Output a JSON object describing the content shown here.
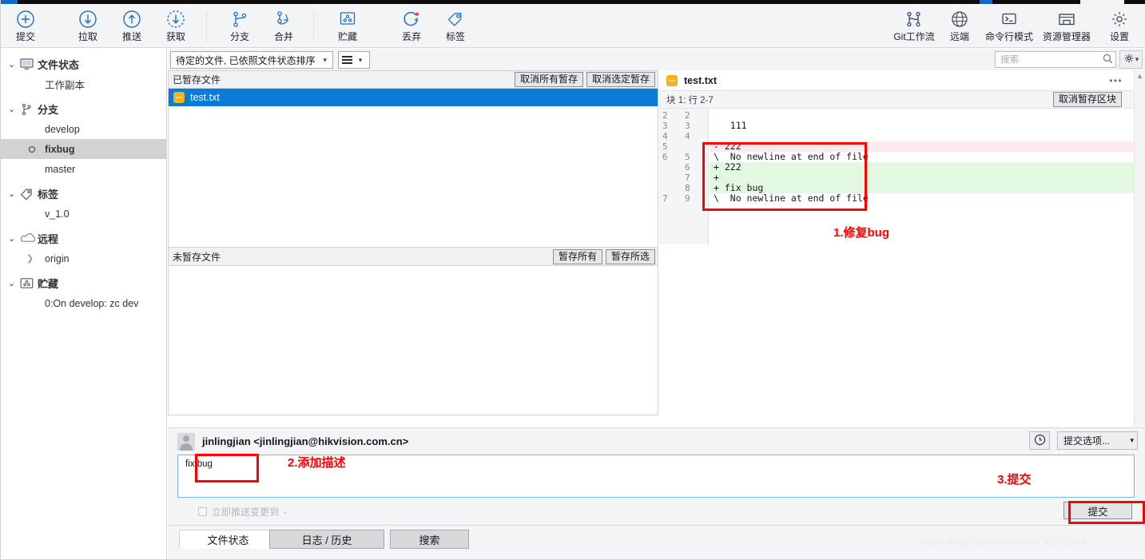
{
  "app": {
    "watermark": "https://blog.csdn.net/weixin_42652596"
  },
  "toolbar": {
    "items": [
      {
        "label": "提交",
        "icon": "commit-plus-circle-icon"
      },
      {
        "label": "拉取",
        "icon": "pull-down-arrow-circle-icon"
      },
      {
        "label": "推送",
        "icon": "push-up-arrow-circle-icon"
      },
      {
        "label": "获取",
        "icon": "fetch-dashed-circle-icon"
      },
      {
        "label": "分支",
        "icon": "branch-icon"
      },
      {
        "label": "合并",
        "icon": "merge-icon"
      },
      {
        "label": "贮藏",
        "icon": "stash-icon"
      },
      {
        "label": "丢弃",
        "icon": "discard-refresh-icon"
      },
      {
        "label": "标签",
        "icon": "tag-icon"
      }
    ],
    "right_items": [
      {
        "label": "Git工作流",
        "icon": "gitflow-icon"
      },
      {
        "label": "远端",
        "icon": "globe-icon"
      },
      {
        "label": "命令行模式",
        "icon": "terminal-icon"
      },
      {
        "label": "资源管理器",
        "icon": "explorer-folder-icon"
      },
      {
        "label": "设置",
        "icon": "gear-icon"
      }
    ]
  },
  "filterbar": {
    "sort_combo": "待定的文件, 已依照文件状态排序",
    "view_combo_icon": "list-view-icon",
    "search_placeholder": "搜索",
    "search_value": "",
    "search_icon": "search-icon",
    "settings_icon": "gear-icon"
  },
  "sidebar": {
    "groups": [
      {
        "label": "文件状态",
        "icon": "monitor-icon",
        "expanded": true,
        "children": [
          {
            "label": "工作副本",
            "selected": false,
            "marker": "none"
          }
        ]
      },
      {
        "label": "分支",
        "icon": "branch-icon",
        "expanded": true,
        "children": [
          {
            "label": "develop",
            "selected": false,
            "marker": "none"
          },
          {
            "label": "fixbug",
            "selected": true,
            "marker": "bullet"
          },
          {
            "label": "master",
            "selected": false,
            "marker": "none"
          }
        ]
      },
      {
        "label": "标签",
        "icon": "tag-icon",
        "expanded": true,
        "children": [
          {
            "label": "v_1.0",
            "selected": false,
            "marker": "none"
          }
        ]
      },
      {
        "label": "远程",
        "icon": "cloud-icon",
        "expanded": true,
        "children": [
          {
            "label": "origin",
            "selected": false,
            "marker": "arrow"
          }
        ]
      },
      {
        "label": "贮藏",
        "icon": "stash-icon",
        "expanded": true,
        "children": [
          {
            "label": "0:On develop: zc dev",
            "selected": false,
            "marker": "none"
          }
        ]
      }
    ]
  },
  "staged": {
    "title": "已暂存文件",
    "unstage_all_label": "取消所有暂存",
    "unstage_selected_label": "取消选定暂存",
    "files": [
      {
        "name": "test.txt",
        "icon": "modified-file-icon",
        "selected": true
      }
    ]
  },
  "unstaged": {
    "title": "未暂存文件",
    "stage_all_label": "暂存所有",
    "stage_selected_label": "暂存所选",
    "files": []
  },
  "diff": {
    "filename": "test.txt",
    "file_icon": "modified-file-icon",
    "more_icon": "ellipsis-icon",
    "hunk_label": "块 1:  行 2-7",
    "unstage_hunk_label": "取消暂存区块",
    "lines": [
      {
        "old": "2",
        "new": "2",
        "text": "",
        "type": "context"
      },
      {
        "old": "3",
        "new": "3",
        "text": "   111",
        "type": "context"
      },
      {
        "old": "4",
        "new": "4",
        "text": "",
        "type": "context"
      },
      {
        "old": "5",
        "new": "",
        "text": "- 222",
        "type": "del"
      },
      {
        "old": "6",
        "new": "5",
        "text": "\\  No newline at end of file",
        "type": "context"
      },
      {
        "old": "",
        "new": "6",
        "text": "+ 222",
        "type": "add"
      },
      {
        "old": "",
        "new": "7",
        "text": "+",
        "type": "add"
      },
      {
        "old": "",
        "new": "8",
        "text": "+ fix bug",
        "type": "add"
      },
      {
        "old": "7",
        "new": "9",
        "text": "\\  No newline at end of file",
        "type": "context"
      }
    ]
  },
  "commit": {
    "author": "jinlingjian <jinlingjian@hikvision.com.cn>",
    "avatar_icon": "avatar-icon",
    "history_icon": "clock-icon",
    "options_label": "提交选项...",
    "message": "fix bug",
    "push_checkbox_label": "立即推送变更到",
    "push_target": "-",
    "commit_button_label": "提交"
  },
  "bottom_tabs": [
    {
      "label": "文件状态",
      "active": true
    },
    {
      "label": "日志 / 历史",
      "active": false
    },
    {
      "label": "搜索",
      "active": false
    }
  ],
  "annotations": [
    {
      "id": "a1",
      "text": "1.修复bug"
    },
    {
      "id": "a2",
      "text": "2.添加描述"
    },
    {
      "id": "a3",
      "text": "3.提交"
    }
  ],
  "colors": {
    "accent": "#0b7bd8",
    "annotation": "#ff0000",
    "diff_add_bg": "#e3f8e1",
    "diff_del_bg": "#fdeaec",
    "toolbar_bg": "#f3f4f6"
  }
}
